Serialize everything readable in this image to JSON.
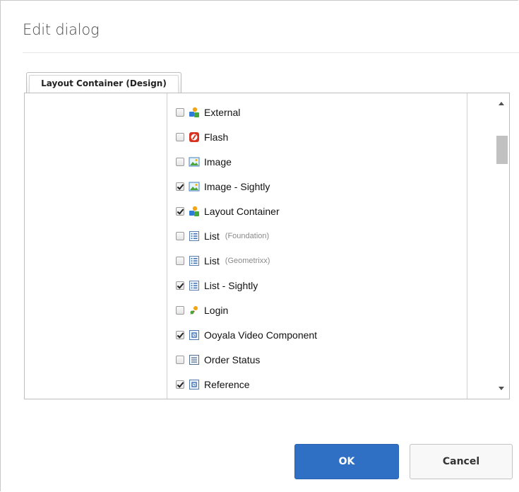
{
  "dialog": {
    "title": "Edit dialog",
    "tab_label": "Layout Container (Design)"
  },
  "components": [
    {
      "label": "External",
      "sublabel": "",
      "checked": false,
      "icon": "components-icon"
    },
    {
      "label": "Flash",
      "sublabel": "",
      "checked": false,
      "icon": "flash-icon"
    },
    {
      "label": "Image",
      "sublabel": "",
      "checked": false,
      "icon": "image-icon"
    },
    {
      "label": "Image - Sightly",
      "sublabel": "",
      "checked": true,
      "icon": "image-icon"
    },
    {
      "label": "Layout Container",
      "sublabel": "",
      "checked": true,
      "icon": "components-icon"
    },
    {
      "label": "List",
      "sublabel": "(Foundation)",
      "checked": false,
      "icon": "list-icon"
    },
    {
      "label": "List",
      "sublabel": "(Geometrixx)",
      "checked": false,
      "icon": "list-icon"
    },
    {
      "label": "List - Sightly",
      "sublabel": "",
      "checked": true,
      "icon": "list-icon"
    },
    {
      "label": "Login",
      "sublabel": "",
      "checked": false,
      "icon": "login-icon"
    },
    {
      "label": "Ooyala Video Component",
      "sublabel": "",
      "checked": true,
      "icon": "component-box-icon"
    },
    {
      "label": "Order Status",
      "sublabel": "",
      "checked": false,
      "icon": "order-status-icon"
    },
    {
      "label": "Reference",
      "sublabel": "",
      "checked": true,
      "icon": "component-box-icon"
    }
  ],
  "buttons": {
    "ok": "OK",
    "cancel": "Cancel"
  },
  "colors": {
    "primary": "#2f6fc4"
  }
}
